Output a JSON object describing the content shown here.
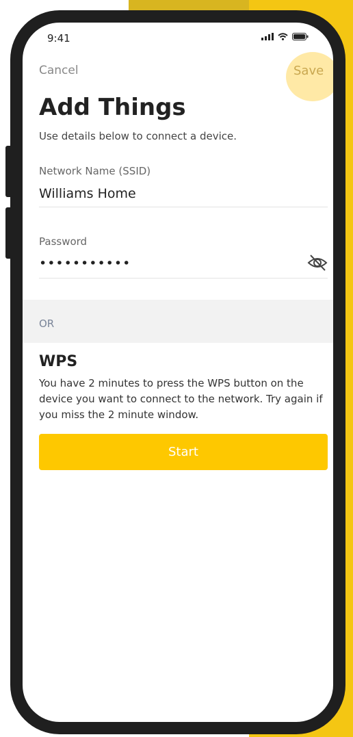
{
  "status_bar": {
    "time": "9:41"
  },
  "nav": {
    "cancel_label": "Cancel",
    "save_label": "Save"
  },
  "header": {
    "title": "Add Things",
    "subtitle": "Use details below to connect a device."
  },
  "form": {
    "network": {
      "label": "Network Name (SSID)",
      "value": "Williams Home"
    },
    "password": {
      "label": "Password",
      "value": "•••••••••••",
      "visibility_icon": "eye-slash-icon"
    }
  },
  "divider": {
    "label": "OR"
  },
  "wps": {
    "title": "WPS",
    "description": "You have 2 minutes to press the WPS button on the device you want to connect to the network. Try again if you miss the 2 minute window.",
    "start_label": "Start"
  },
  "colors": {
    "accent": "#fec800",
    "background_accent": "#f4c613",
    "phone_frame": "#1f1f1f",
    "save_highlight": "#ffe9a6"
  }
}
